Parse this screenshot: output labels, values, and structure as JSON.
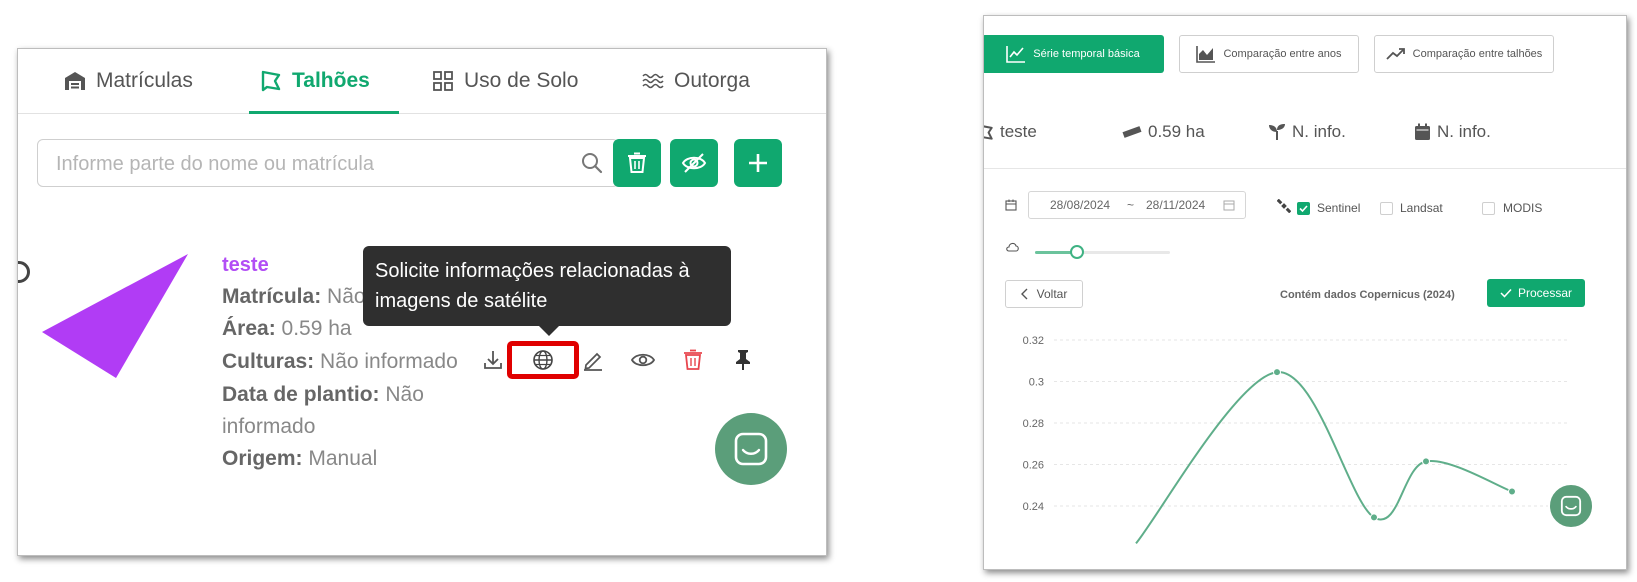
{
  "left": {
    "tabs": [
      {
        "label": "Matrículas",
        "icon": "warehouse-icon",
        "active": false
      },
      {
        "label": "Talhões",
        "icon": "map-plot-icon",
        "active": true
      },
      {
        "label": "Uso de Solo",
        "icon": "grid-icon",
        "active": false
      },
      {
        "label": "Outorga",
        "icon": "water-waves-icon",
        "active": false
      }
    ],
    "search_placeholder": "Informe parte do nome ou matrícula",
    "plot": {
      "name": "teste",
      "matricula_label": "Matrícula:",
      "matricula_value": "Não",
      "area_label": "Área:",
      "area_value": "0.59 ha",
      "culturas_label": "Culturas:",
      "culturas_value": "Não informado",
      "plantio_label": "Data de plantio:",
      "plantio_value_1": "Não",
      "plantio_value_2": "informado",
      "origem_label": "Origem:",
      "origem_value": "Manual",
      "shape_color": "#b13cf5"
    },
    "tooltip_line1": "Solicite informações relacionadas à",
    "tooltip_line2": "imagens de satélite",
    "accent": "#10a86f",
    "highlight_color": "#e00000"
  },
  "right": {
    "buttons": [
      {
        "label": "Série temporal básica",
        "primary": true
      },
      {
        "label": "Comparação entre anos",
        "primary": false
      },
      {
        "label": "Comparação entre talhões",
        "primary": false
      }
    ],
    "stats": {
      "name": "teste",
      "area": "0.59 ha",
      "crop": "N. info.",
      "date": "N. info."
    },
    "date_start": "28/08/2024",
    "date_sep": "~",
    "date_end": "28/11/2024",
    "sources": [
      {
        "label": "Sentinel",
        "checked": true
      },
      {
        "label": "Landsat",
        "checked": false
      },
      {
        "label": "MODIS",
        "checked": false
      }
    ],
    "cloud_slider_fraction": 0.3,
    "back_label": "Voltar",
    "copernicus_note": "Contém dados Copernicus (2024)",
    "process_label": "Processar"
  },
  "chart_data": {
    "type": "line",
    "title": "",
    "xlabel": "",
    "ylabel": "",
    "ylim": [
      0.23,
      0.32
    ],
    "yticks": [
      "0.32",
      "0.3",
      "0.28",
      "0.26",
      "0.24"
    ],
    "grid": true,
    "series": [
      {
        "points": [
          [
            0,
            0.222
          ],
          [
            1,
            0.3045
          ],
          [
            2,
            0.2345
          ],
          [
            3,
            0.2615
          ],
          [
            4,
            0.247
          ]
        ]
      }
    ],
    "line_color": "#5fae8a"
  }
}
